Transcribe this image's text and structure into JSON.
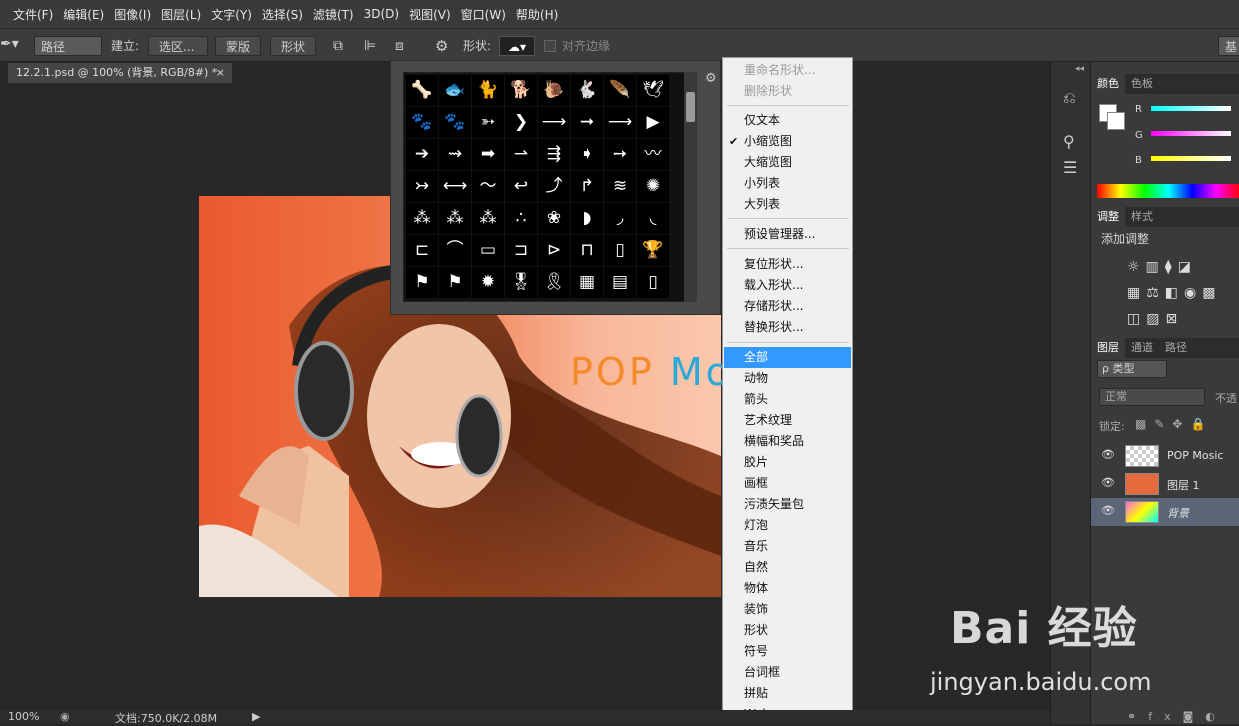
{
  "menubar": [
    "文件(F)",
    "编辑(E)",
    "图像(I)",
    "图层(L)",
    "文字(Y)",
    "选择(S)",
    "滤镜(T)",
    "3D(D)",
    "视图(V)",
    "窗口(W)",
    "帮助(H)"
  ],
  "options": {
    "mode": "路径",
    "make_label": "建立:",
    "selection_btn": "选区...",
    "mask_btn": "蒙版",
    "shape_btn": "形状",
    "shape_label": "形状:",
    "align_edges": "对齐边缘",
    "right_btn": "基"
  },
  "doc": {
    "tab_title": "12.2.1.psd @ 100% (背景, RGB/8#) *",
    "close": "×",
    "pop_text_a": "POP",
    "pop_text_b": "Mo",
    "zoom": "100%",
    "doc_info": "文档:750.0K/2.08M"
  },
  "shapes": [
    "🦴",
    "🐟",
    "🐈",
    "🐕",
    "🐌",
    "🐇",
    "🪶",
    "🕊",
    "🐾",
    "🐾",
    "➳",
    "❯",
    "⟶",
    "➞",
    "⟶",
    "▶",
    "➔",
    "⇝",
    "➡",
    "⇀",
    "⇶",
    "➧",
    "➙",
    "〰",
    "↣",
    "⟷",
    "〜",
    "↩",
    "⤴",
    "↱",
    "≋",
    "✺",
    "⁂",
    "⁂",
    "⁂",
    "∴",
    "❀",
    "◗",
    "◞",
    "◟",
    "⊏",
    "⌒",
    "▭",
    "⊐",
    "⊳",
    "⊓",
    "▯",
    "🏆",
    "⚑",
    "⚑",
    "✹",
    "🎖",
    "🎗",
    "▦",
    "▤",
    "▯"
  ],
  "menu": {
    "rename": "重命名形状...",
    "delete": "删除形状",
    "text_only": "仅文本",
    "small_thumb": "小缩览图",
    "large_thumb": "大缩览图",
    "small_list": "小列表",
    "large_list": "大列表",
    "preset_mgr": "预设管理器...",
    "reset": "复位形状...",
    "load": "载入形状...",
    "save": "存储形状...",
    "replace": "替换形状...",
    "all": "全部",
    "animals": "动物",
    "arrows": "箭头",
    "art": "艺术纹理",
    "banners": "横幅和奖品",
    "film": "胶片",
    "frames": "画框",
    "grime": "污渍矢量包",
    "bulb": "灯泡",
    "music": "音乐",
    "nature": "自然",
    "objects": "物体",
    "ornaments": "装饰",
    "shapes": "形状",
    "symbols": "符号",
    "talk": "台词框",
    "tiles": "拼贴",
    "web": "Web",
    "checkmark": "✔"
  },
  "panels": {
    "color_tab": "颜色",
    "swatch_tab": "色板",
    "r": "R",
    "g": "G",
    "b": "B",
    "adjust_tab": "调整",
    "style_tab": "样式",
    "add_adjust": "添加调整",
    "layers_tab": "图层",
    "channels_tab": "通道",
    "paths_tab": "路径",
    "kind": "ρ 类型",
    "blend": "正常",
    "opacity": "不透",
    "lock": "锁定:",
    "layer1": "POP Mosic",
    "layer2": "图层 1",
    "layer3": "背景"
  },
  "watermark": {
    "logo": "Bai 经验",
    "url": "jingyan.baidu.com"
  },
  "colors": {
    "accent": "#3399ff",
    "photo_orange": "#f07a4c",
    "pop_orange": "#f58a2a",
    "pop_blue": "#2aa8d8"
  }
}
